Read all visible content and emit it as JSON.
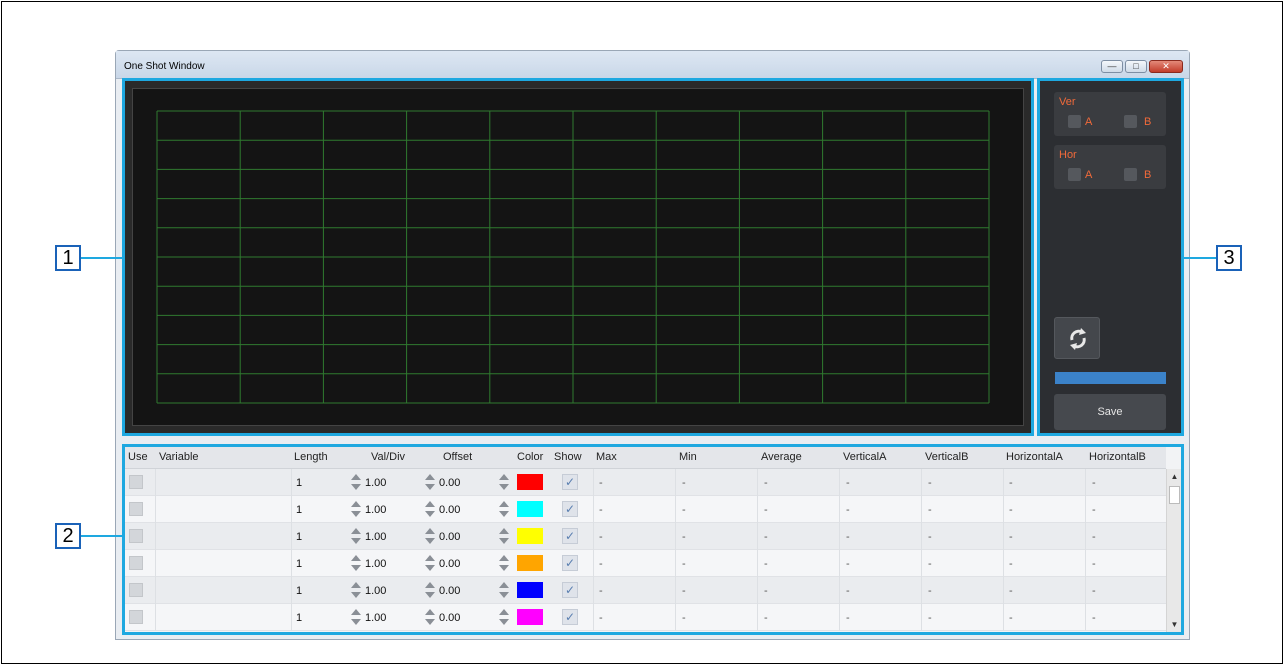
{
  "window": {
    "title": "One Shot Window"
  },
  "controls": {
    "ver": {
      "title": "Ver",
      "a": "A",
      "b": "B"
    },
    "hor": {
      "title": "Hor",
      "a": "A",
      "b": "B"
    },
    "save_label": "Save"
  },
  "table": {
    "headers": [
      "Use",
      "Variable",
      "Length",
      "Val/Div",
      "Offset",
      "Color",
      "Show",
      "Max",
      "Min",
      "Average",
      "VerticalA",
      "VerticalB",
      "HorizontalA",
      "HorizontalB"
    ],
    "rows": [
      {
        "length": "1",
        "valdiv": "1.00",
        "offset": "0.00",
        "color": "#ff0000",
        "max": "-",
        "min": "-",
        "average": "-",
        "va": "-",
        "vb": "-",
        "ha": "-",
        "hb": "-"
      },
      {
        "length": "1",
        "valdiv": "1.00",
        "offset": "0.00",
        "color": "#00ffff",
        "max": "-",
        "min": "-",
        "average": "-",
        "va": "-",
        "vb": "-",
        "ha": "-",
        "hb": "-"
      },
      {
        "length": "1",
        "valdiv": "1.00",
        "offset": "0.00",
        "color": "#ffff00",
        "max": "-",
        "min": "-",
        "average": "-",
        "va": "-",
        "vb": "-",
        "ha": "-",
        "hb": "-"
      },
      {
        "length": "1",
        "valdiv": "1.00",
        "offset": "0.00",
        "color": "#ffa500",
        "max": "-",
        "min": "-",
        "average": "-",
        "va": "-",
        "vb": "-",
        "ha": "-",
        "hb": "-"
      },
      {
        "length": "1",
        "valdiv": "1.00",
        "offset": "0.00",
        "color": "#0000ff",
        "max": "-",
        "min": "-",
        "average": "-",
        "va": "-",
        "vb": "-",
        "ha": "-",
        "hb": "-"
      },
      {
        "length": "1",
        "valdiv": "1.00",
        "offset": "0.00",
        "color": "#ff00ff",
        "max": "-",
        "min": "-",
        "average": "-",
        "va": "-",
        "vb": "-",
        "ha": "-",
        "hb": "-"
      }
    ]
  },
  "callouts": {
    "c1": "1",
    "c2": "2",
    "c3": "3"
  },
  "colors": {
    "grid": "#2f7a2f",
    "highlight": "#1ea8e0"
  }
}
